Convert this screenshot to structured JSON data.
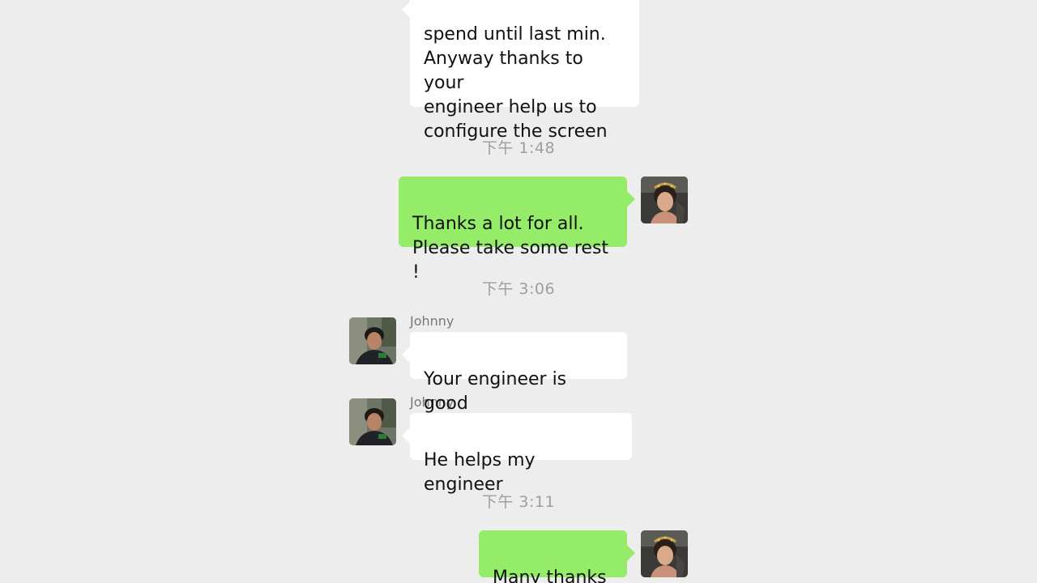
{
  "chat": {
    "messages": [
      {
        "direction": "incoming",
        "text": "spend until last min.\nAnyway thanks to your\nengineer help us to\nconfigure the screen"
      },
      {
        "direction": "outgoing",
        "text": "Thanks a lot for all.\nPlease take some rest !"
      },
      {
        "direction": "incoming",
        "sender": "Johnny",
        "text": "Your engineer is good"
      },
      {
        "direction": "incoming",
        "sender": "Johnny",
        "text": "He helps my engineer"
      },
      {
        "direction": "outgoing",
        "text": "Many thanks !"
      }
    ],
    "timestamps": [
      "下午 1:48",
      "下午 3:06",
      "下午 3:11"
    ]
  },
  "colors": {
    "background": "#ededed",
    "incoming_bubble": "#ffffff",
    "outgoing_bubble": "#95ec69",
    "timestamp_text": "#9e9e9e",
    "sender_text": "#777777"
  },
  "icons": {
    "self_avatar": "woman-portrait-avatar",
    "contact_avatar": "man-portrait-avatar"
  }
}
